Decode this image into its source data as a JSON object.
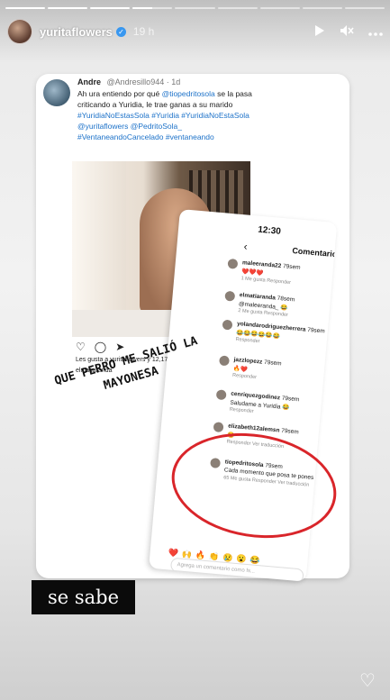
{
  "story": {
    "username": "yuritaflowers",
    "time": "19 h",
    "progress": [
      1,
      1,
      1,
      0.5,
      0,
      0,
      0,
      0,
      0
    ]
  },
  "icons": {
    "verified": "verified-badge-icon",
    "play": "play-icon",
    "mute": "mute-icon",
    "more": "more-icon",
    "like": "heart-icon"
  },
  "tweet": {
    "name": "Andre",
    "handle": "@Andresillo944 · 1d",
    "text_a": "Ah ura entiendo por qué ",
    "mention1": "@tiopedritosola",
    "text_b": " se la pasa criticando a Yuridia, le trae ganas a su marido ",
    "tags1": "#YuridiaNoEstasSola #Yuridia #YuridiaNoEstaSola @yuritaflowers @PedritoSola_ #VentaneandoCancelado #ventaneando"
  },
  "post": {
    "likes": "Les gusta a yuritaflowers y 12,175 más",
    "liker": "elmatiaranda"
  },
  "phone": {
    "time": "12:30",
    "title": "Comentarios",
    "comments": [
      {
        "user": "maleeranda22",
        "meta": "79sem",
        "text": "❤️❤️❤️",
        "reply": "1 Me gusta   Responder"
      },
      {
        "user": "elmatiaranda",
        "meta": "78sem",
        "text": "@maleeranda_ 😂",
        "reply": "2 Me gusta   Responder"
      },
      {
        "user": "yolandarodriguezherrera",
        "meta": "79sem",
        "text": "😂😂😂😂😂😂",
        "reply": "Responder"
      },
      {
        "user": "jazzlopezz",
        "meta": "79sem",
        "text": "🔥❤️",
        "reply": "Responder"
      },
      {
        "user": "cenriquezgodinez",
        "meta": "79sem",
        "text": "Saludame a Yuridia 😂",
        "reply": "Responder"
      },
      {
        "user": "elizabeth12alemsn",
        "meta": "79sem",
        "text": "😂",
        "reply": "Responder   Ver traducción"
      },
      {
        "user": "tiopedritosola",
        "meta": "79sem",
        "text": "Cada momento que posa te pones mas guapo amigo.",
        "reply": "65 Me gusta   Responder   Ver traducción"
      }
    ],
    "emojis": "❤️🙌🔥👏😢😮😂",
    "input_placeholder": "Agrega un comentario como fs..."
  },
  "overlay": {
    "hand_text": "QUE PERRO ME SALIÓ LA MAYONESA",
    "sticker": "se sabe"
  }
}
